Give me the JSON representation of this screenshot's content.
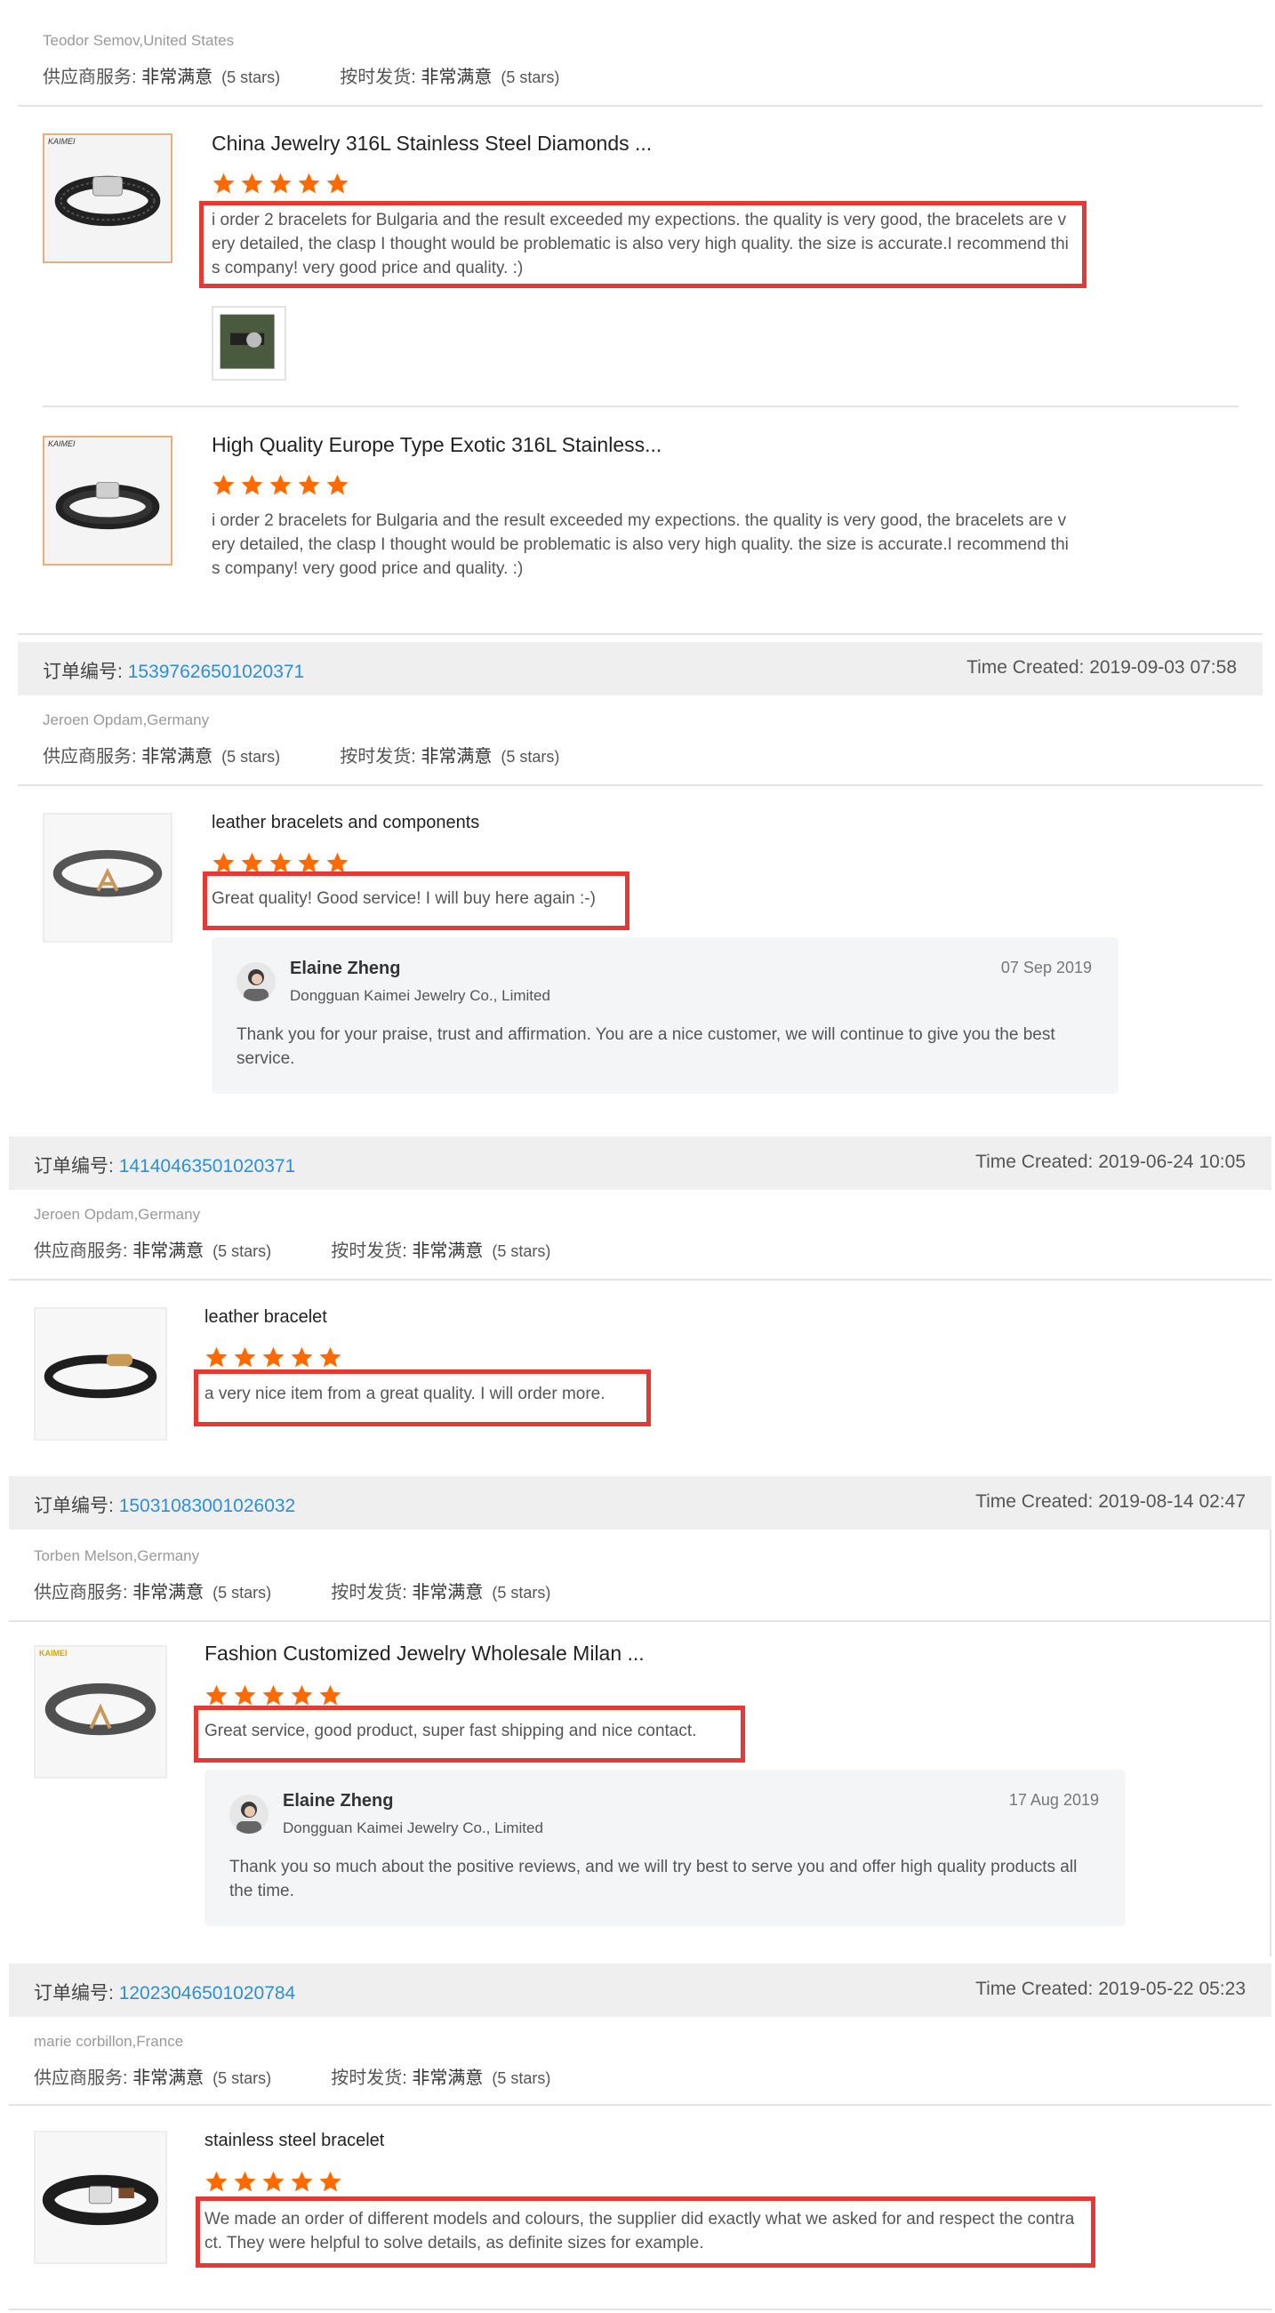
{
  "labels": {
    "supplier_service": "供应商服务:",
    "on_time_delivery": "按时发货:",
    "very_satisfied": "非常满意",
    "five_stars": "(5 stars)",
    "order_no": "订单编号:",
    "time_created": "Time Created:"
  },
  "colors": {
    "star": "#ff6a00",
    "link": "#2d8fd5",
    "highlight": "#e53935"
  },
  "first_order": {
    "buyer": "Teodor Semov,United States",
    "products": [
      {
        "title": "China Jewelry 316L Stainless Steel Diamonds ...",
        "brand": "KAIMEI",
        "review": "i order 2 bracelets for Bulgaria and the result exceeded my expections. the quality is very good, the bracelets are very detailed, the clasp I thought would be problematic is also very high quality. the size is accurate.I recommend this company! very good price and quality. :)",
        "rating": 5
      },
      {
        "title": "High Quality Europe Type Exotic 316L Stainless...",
        "brand": "KAIMEI",
        "review": "i order 2 bracelets for Bulgaria and the result exceeded my expections. the quality is very good, the bracelets are very detailed, the clasp I thought would be problematic is also very high quality. the size is accurate.I recommend this company! very good price and quality. :)",
        "rating": 5
      }
    ]
  },
  "orders": [
    {
      "order_no": "15397626501020371",
      "time": "2019-09-03 07:58",
      "buyer": "Jeroen Opdam,Germany",
      "product": "leather bracelets and components",
      "rating": 5,
      "review": "Great quality! Good service! I will buy here again :-)",
      "reply": {
        "name": "Elaine Zheng",
        "company": "Dongguan Kaimei Jewelry Co., Limited",
        "date": "07 Sep 2019",
        "text": "Thank you for your praise, trust and affirmation. You are a nice customer, we will continue to give you the best service."
      }
    },
    {
      "order_no": "14140463501020371",
      "time": "2019-06-24 10:05",
      "buyer": "Jeroen Opdam,Germany",
      "product": "leather bracelet",
      "rating": 5,
      "review": "a very nice item from a great quality. I will order more."
    },
    {
      "order_no": "15031083001026032",
      "time": "2019-08-14 02:47",
      "buyer": "Torben Melson,Germany",
      "product": "Fashion Customized Jewelry Wholesale Milan ...",
      "brand": "KAIMEI",
      "rating": 5,
      "review": "Great service, good product, super fast shipping and nice contact.",
      "reply": {
        "name": "Elaine Zheng",
        "company": "Dongguan Kaimei Jewelry Co., Limited",
        "date": "17 Aug 2019",
        "text": "Thank you so much about the positive reviews, and we will try best to serve you and offer high quality products all the time."
      }
    },
    {
      "order_no": "12023046501020784",
      "time": "2019-05-22 05:23",
      "buyer": "marie corbillon,France",
      "product": "stainless steel bracelet",
      "rating": 5,
      "review": "We made an order of different models and colours, the supplier did exactly what we asked for and respect the contract. They were helpful to solve details, as definite sizes for example."
    }
  ]
}
